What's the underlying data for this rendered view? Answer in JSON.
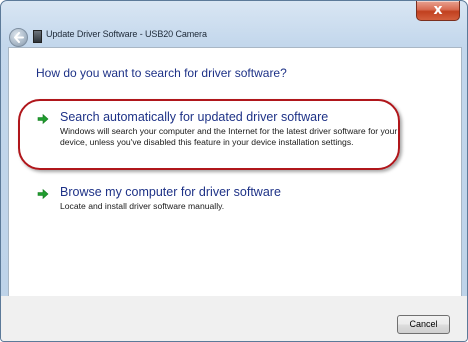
{
  "window": {
    "title": "Update Driver Software - USB20 Camera",
    "close_label": "x"
  },
  "heading": "How do you want to search for driver software?",
  "options": [
    {
      "title": "Search automatically for updated driver software",
      "description": "Windows will search your computer and the Internet for the latest driver software for your device, unless you've disabled this feature in your device installation settings."
    },
    {
      "title": "Browse my computer for driver software",
      "description": "Locate and install driver software manually."
    }
  ],
  "footer": {
    "cancel_label": "Cancel"
  },
  "icons": {
    "back": "back-arrow-icon",
    "driver": "driver-device-icon",
    "option_arrow": "green-arrow-icon",
    "close": "close-icon"
  },
  "colors": {
    "accent_text": "#1e3287",
    "highlight": "#b0161b",
    "arrow_green": "#1f9d2e",
    "close_red": "#c7452a"
  }
}
